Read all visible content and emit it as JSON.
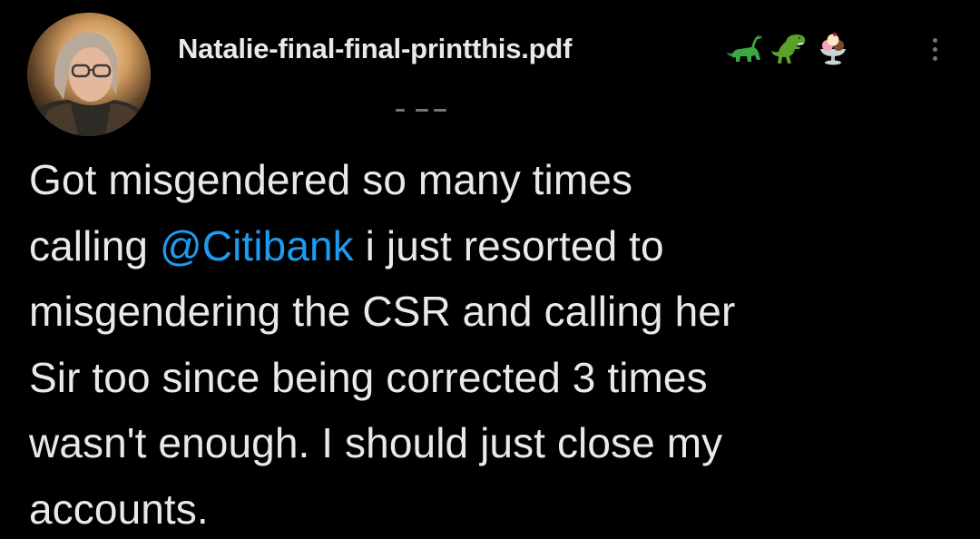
{
  "tweet": {
    "author": {
      "display_name": "Natalie-final-final-printthis.pdf",
      "name_emojis": [
        "sauropod-emoji",
        "t-rex-emoji",
        "ice-cream-emoji"
      ],
      "avatar": "profile-photo"
    },
    "more_icon": "more-vertical-icon",
    "text_lines": [
      {
        "before": "Got misgendered so many times",
        "mention": "",
        "after": ""
      },
      {
        "before": "calling ",
        "mention": "@Citibank",
        "after": " i just resorted to"
      },
      {
        "before": "misgendering the CSR and calling her",
        "mention": "",
        "after": ""
      },
      {
        "before": "Sir too since being corrected 3 times",
        "mention": "",
        "after": ""
      },
      {
        "before": "wasn't enough. I should just close my",
        "mention": "",
        "after": ""
      },
      {
        "before": "accounts.",
        "mention": "",
        "after": ""
      }
    ]
  },
  "colors": {
    "background": "#000000",
    "text": "#e7e9ea",
    "mention": "#1d9bf0",
    "secondary": "#71767b"
  }
}
